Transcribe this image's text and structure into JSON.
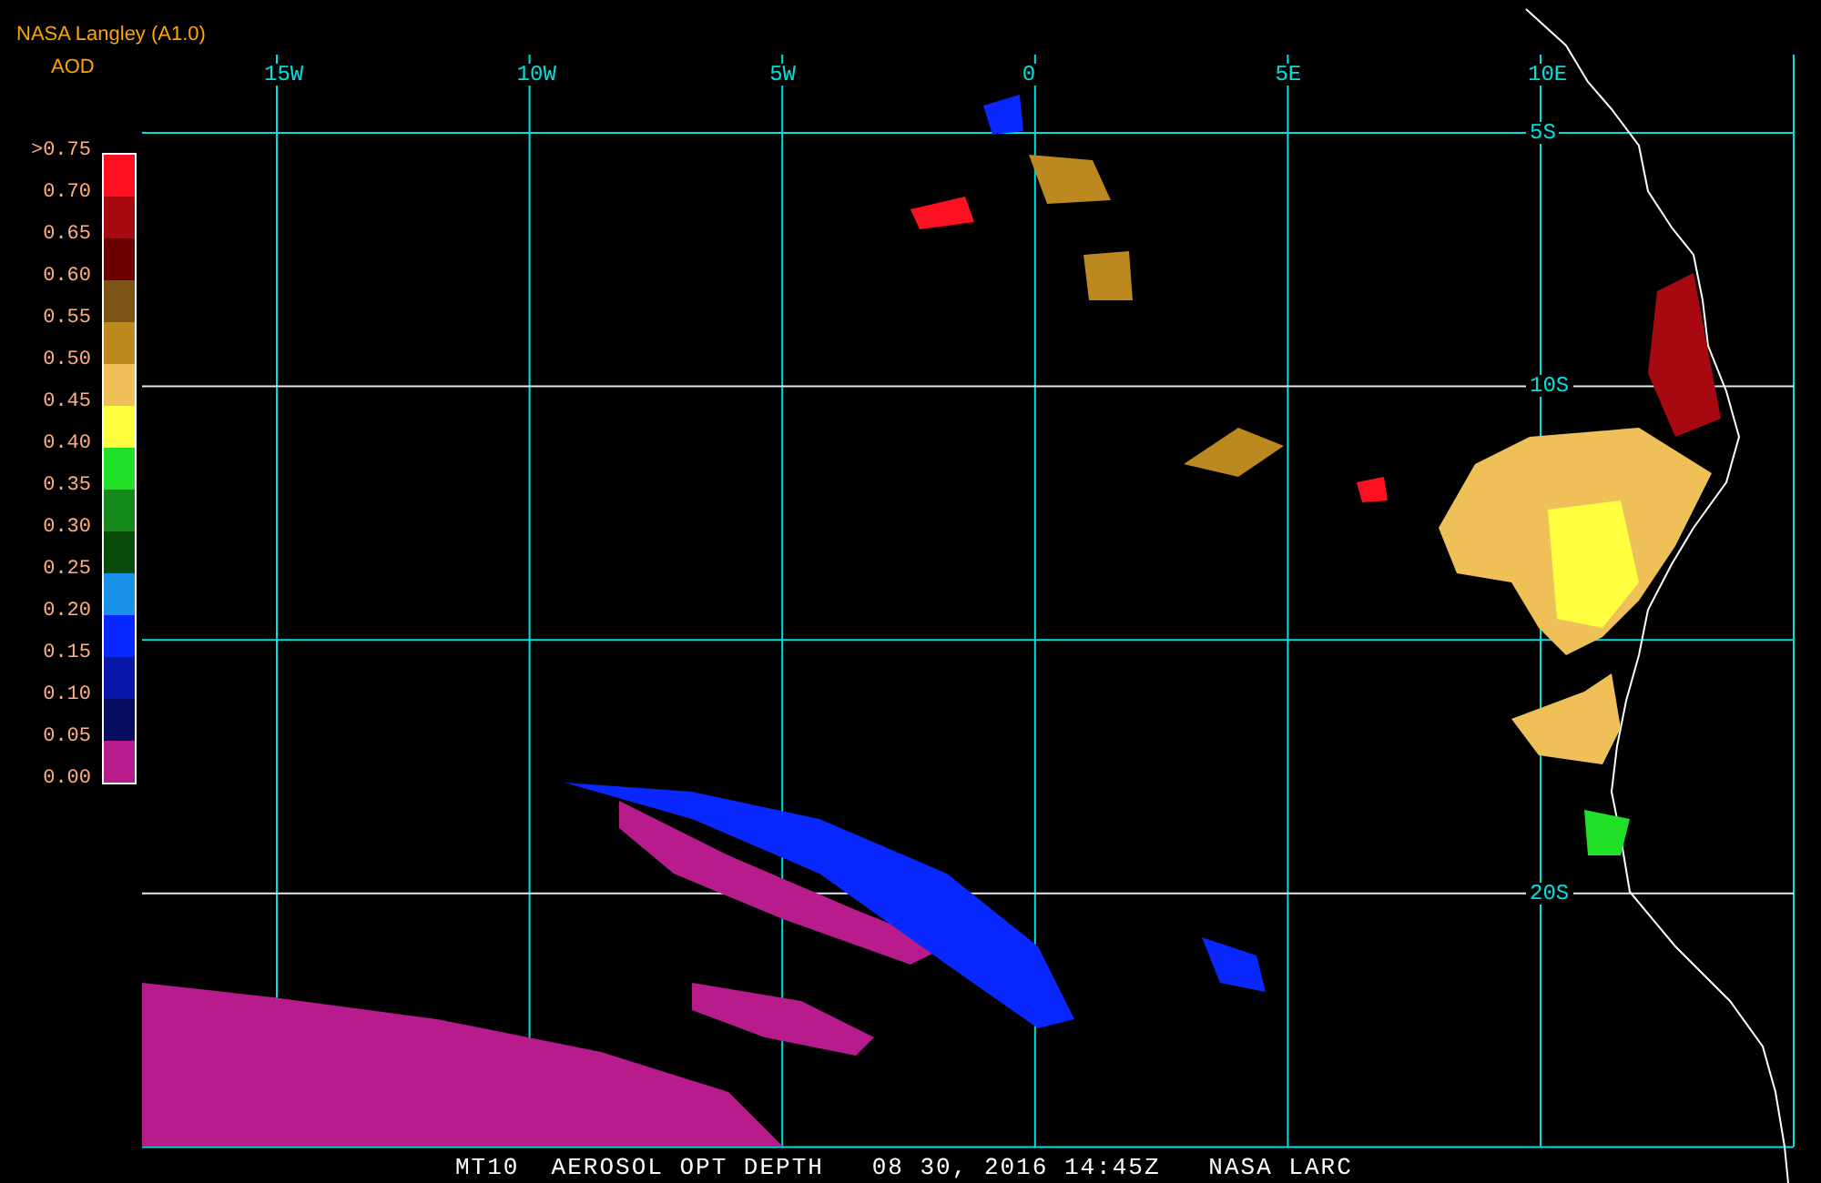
{
  "header": {
    "title": "NASA Langley (A1.0)",
    "subtitle": "AOD"
  },
  "legend": [
    {
      "label": ">0.75",
      "color": "#ff1020"
    },
    {
      "label": "0.70",
      "color": "#a80810"
    },
    {
      "label": "0.65",
      "color": "#6c0000"
    },
    {
      "label": "0.60",
      "color": "#7c5414"
    },
    {
      "label": "0.55",
      "color": "#bc8820"
    },
    {
      "label": "0.50",
      "color": "#f0c058"
    },
    {
      "label": "0.45",
      "color": "#ffff40"
    },
    {
      "label": "0.40",
      "color": "#20e028"
    },
    {
      "label": "0.35",
      "color": "#148818"
    },
    {
      "label": "0.30",
      "color": "#084c0c"
    },
    {
      "label": "0.25",
      "color": "#1890e8"
    },
    {
      "label": "0.20",
      "color": "#0828ff"
    },
    {
      "label": "0.15",
      "color": "#0818a8"
    },
    {
      "label": "0.10",
      "color": "#060c60"
    },
    {
      "label": "0.05",
      "color": "#b81c8c"
    }
  ],
  "legend_bottom_label": "0.00",
  "map": {
    "longitude_labels": [
      "15W",
      "10W",
      "5W",
      "0",
      "5E",
      "10E"
    ],
    "latitude_labels": [
      "5S",
      "10S",
      "20S"
    ]
  },
  "caption": "MT10  AEROSOL OPT DEPTH   08 30, 2016 14:45Z   NASA LARC"
}
